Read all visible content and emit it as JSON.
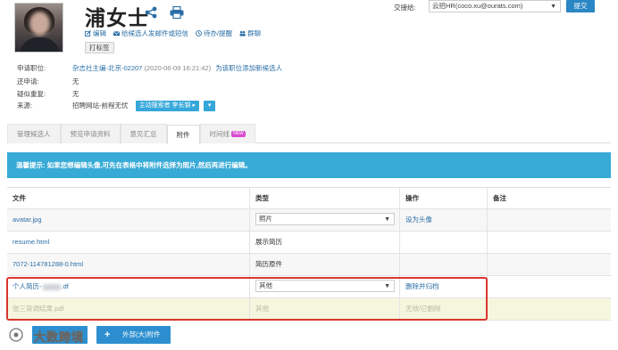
{
  "profile": {
    "name": "浦女士",
    "actions": [
      "编辑",
      "给候选人发邮件或短信",
      "待办/提醒",
      "群聊"
    ],
    "tag_button": "打标签"
  },
  "transfer": {
    "label": "交接给:",
    "selected": "云招HR(coco.xu@ourats.com)",
    "submit": "提交"
  },
  "info": {
    "position_label": "申请职位:",
    "position_value": "杂志社主编-北京-02207",
    "position_date": "(2020-06-09 16:21:42)",
    "position_link": "为该职位添加新候选人",
    "also_label": "还申请:",
    "also_value": "无",
    "suspect_label": "疑似重复:",
    "suspect_value": "无",
    "source_label": "来源:",
    "source_value": "招聘网站-前程无忧",
    "search_btn": "主动搜索者 李长钢",
    "search_btn_arrow": "▸",
    "dropdown_btn": "▾"
  },
  "tabs": [
    {
      "label": "管理候选人"
    },
    {
      "label": "预览申请资料"
    },
    {
      "label": "意见汇总"
    },
    {
      "label": "附件"
    },
    {
      "label": "时间线"
    }
  ],
  "tab_badge": "NEW",
  "alert": "温馨提示: 如果您想编辑头像,可先在表格中将附件选择为照片,然后再进行编辑。",
  "table": {
    "headers": [
      "文件",
      "类型",
      "操作",
      "备注"
    ],
    "rows": [
      {
        "file": "avatar.jpg",
        "type": "照片",
        "action": "设为头像",
        "note": ""
      },
      {
        "file": "resume.html",
        "type": "展示简历",
        "action": "",
        "note": ""
      },
      {
        "file": "7072-114781288-0.html",
        "type": "简历原件",
        "action": "",
        "note": ""
      },
      {
        "file_prefix": "个人简历-",
        "file_suffix": ".df",
        "type": "其他",
        "action": "删除并归档",
        "note": ""
      },
      {
        "file": "张三背调结果.pdf",
        "type": "其他",
        "action": "无效/已删除",
        "note": ""
      }
    ]
  },
  "upload_button": "外部(大)附件",
  "watermark": "大数跨境",
  "colors": {
    "accent": "#2a86c4",
    "alert_bg": "#37aad6",
    "highlight_border": "#d9362f",
    "archived_row_bg": "#f5f6dd"
  },
  "icons": {
    "share": "share-icon",
    "print": "print-icon",
    "edit": "edit-icon",
    "mail": "mail-icon",
    "todo": "todo-icon",
    "group": "group-chat-icon",
    "plus": "plus-icon"
  }
}
